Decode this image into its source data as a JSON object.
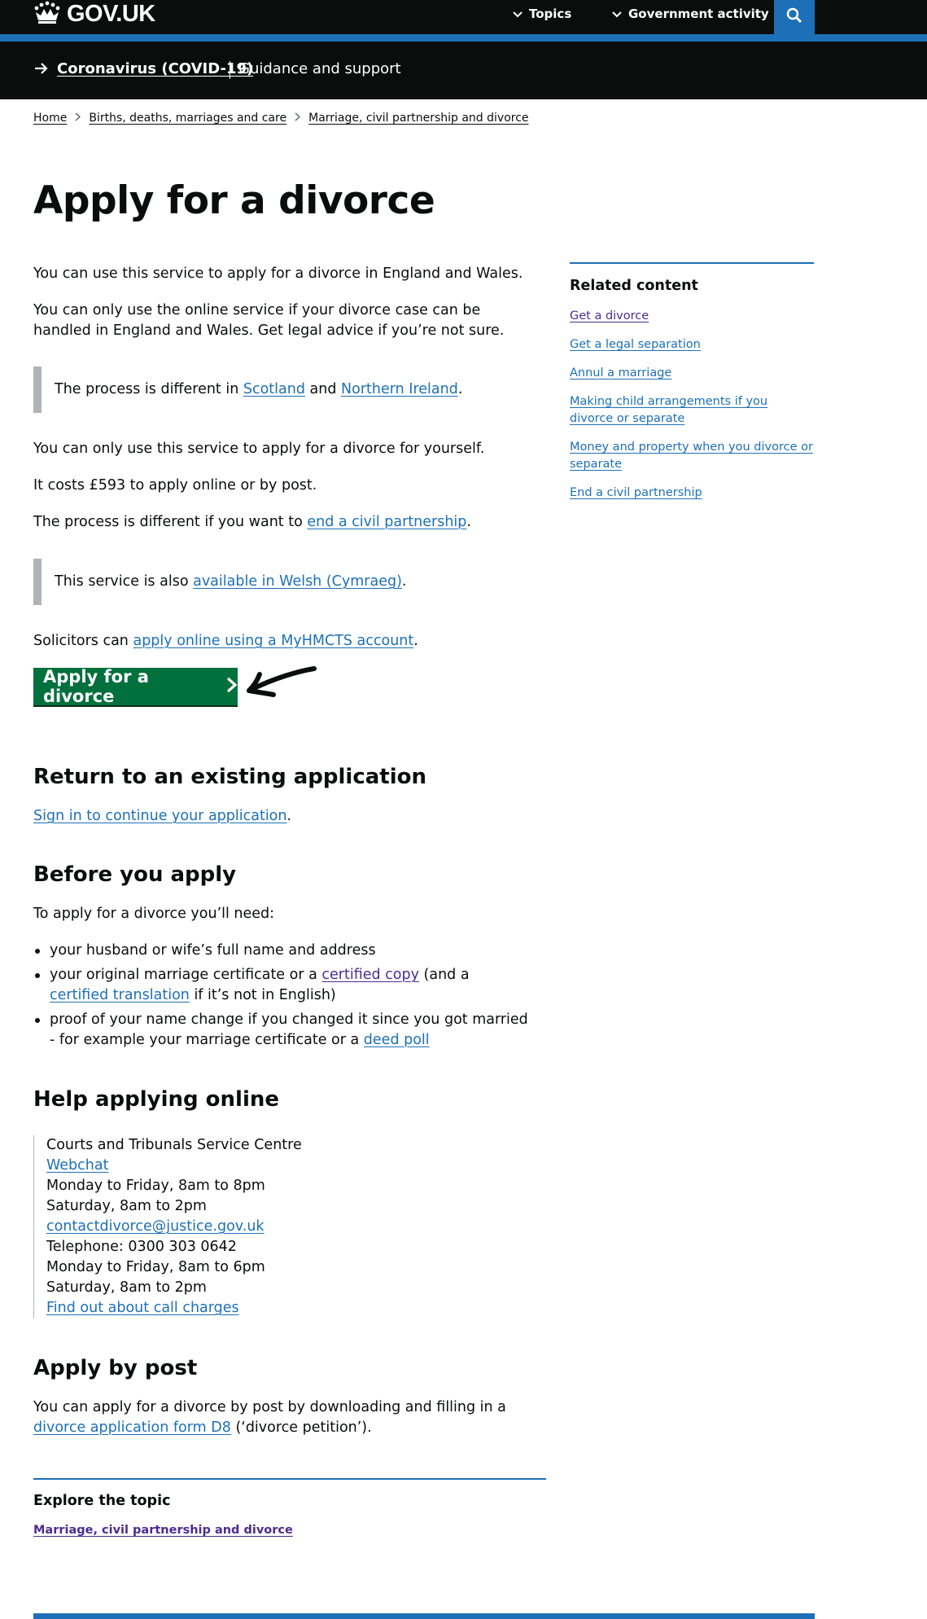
{
  "header": {
    "logo_text": "GOV.UK",
    "nav": [
      {
        "label": "Topics"
      },
      {
        "label": "Government activity"
      }
    ],
    "search_icon": "search-icon"
  },
  "covid_banner": {
    "link": "Coronavirus (COVID-19)",
    "text": "Guidance and support"
  },
  "breadcrumb": [
    "Home",
    "Births, deaths, marriages and care",
    "Marriage, civil partnership and divorce"
  ],
  "page_title": "Apply for a divorce",
  "intro": {
    "p1": "You can use this service to apply for a divorce in England and Wales.",
    "p2": "You can only use the online service if your divorce case can be handled in England and Wales. Get legal advice if you’re not sure.",
    "inset1": {
      "before": "The process is different in ",
      "link1": "Scotland",
      "mid": " and ",
      "link2": "Northern Ireland",
      "after": "."
    },
    "p3": "You can only use this service to apply for a divorce for yourself.",
    "p4": "It costs £593 to apply online or by post.",
    "p5": {
      "before": "The process is different if you want to ",
      "link": "end a civil partnership",
      "after": "."
    },
    "inset2": {
      "before": "This service is also ",
      "link": "available in Welsh (Cymraeg)",
      "after": "."
    },
    "p6": {
      "before": "Solicitors can ",
      "link": "apply online using a MyHMCTS account",
      "after": "."
    }
  },
  "start_button": {
    "label": "Apply for a divorce"
  },
  "return": {
    "heading": "Return to an existing application",
    "link": "Sign in to continue your application",
    "after": "."
  },
  "before": {
    "heading": "Before you apply",
    "intro": "To apply for a divorce you’ll need:",
    "b1": "your husband or wife’s full name and address",
    "b2": {
      "before": "your original marriage certificate or a ",
      "link1": "certified copy",
      "mid": " (and a ",
      "link2": "certified translation",
      "after": " if it’s not in English)"
    },
    "b3": {
      "before": "proof of your name change if you changed it since you got married - for example your marriage certificate or a ",
      "link": "deed poll"
    }
  },
  "help": {
    "heading": "Help applying online",
    "lines": {
      "l1": "Courts and Tribunals Service Centre",
      "webchat": "Webchat",
      "l3": "Monday to Friday, 8am to 8pm",
      "l4": "Saturday, 8am to 2pm",
      "email": "contactdivorce@justice.gov.uk",
      "l6": "Telephone: 0300 303 0642",
      "l7": "Monday to Friday, 8am to 6pm",
      "l8": "Saturday, 8am to 2pm",
      "charges": "Find out about call charges"
    }
  },
  "post": {
    "heading": "Apply by post",
    "before": "You can apply for a divorce by post by downloading and filling in a ",
    "link": "divorce application form D8",
    "after": " (‘divorce petition’)."
  },
  "sidebar": {
    "title": "Related content",
    "links": [
      "Get a divorce",
      "Get a legal separation",
      "Annul a marriage",
      "Making child arrangements if you divorce or separate",
      "Money and property when you divorce or separate",
      "End a civil partnership"
    ]
  },
  "explore": {
    "title": "Explore the topic",
    "link": "Marriage, civil partnership and divorce"
  },
  "colors": {
    "link": "#1d70b8",
    "visited": "#4c2c92",
    "start_button": "#00703c",
    "header": "#0b0c0c"
  }
}
